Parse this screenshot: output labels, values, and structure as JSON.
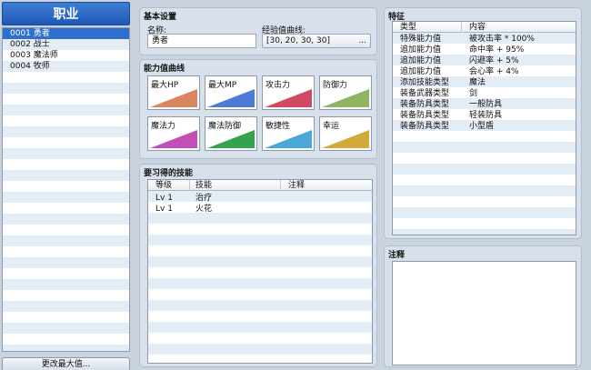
{
  "left": {
    "title": "职业",
    "classes": [
      "0001 勇者",
      "0002 战士",
      "0003 魔法师",
      "0004 牧师"
    ],
    "change_max_button": "更改最大值..."
  },
  "basic": {
    "title": "基本设置",
    "name_label": "名称:",
    "name_value": "勇者",
    "exp_label": "经验值曲线:",
    "exp_value": "[30, 20, 30, 30]",
    "exp_button": "..."
  },
  "curves": {
    "title": "能力值曲线",
    "items": [
      {
        "label": "最大HP",
        "color": "#d98560"
      },
      {
        "label": "最大MP",
        "color": "#4f7ad6"
      },
      {
        "label": "攻击力",
        "color": "#cf4a62"
      },
      {
        "label": "防御力",
        "color": "#90b466"
      },
      {
        "label": "魔法力",
        "color": "#c24fb8"
      },
      {
        "label": "魔法防御",
        "color": "#35a24e"
      },
      {
        "label": "敏捷性",
        "color": "#4aa7d8"
      },
      {
        "label": "幸运",
        "color": "#d2aa3c"
      }
    ]
  },
  "skills": {
    "title": "要习得的技能",
    "headers": [
      "等级",
      "技能",
      "注释"
    ],
    "rows": [
      {
        "level": "Lv  1",
        "skill": "治疗",
        "note": ""
      },
      {
        "level": "Lv  1",
        "skill": "火花",
        "note": ""
      }
    ]
  },
  "traits": {
    "title": "特征",
    "headers": [
      "类型",
      "内容"
    ],
    "rows": [
      {
        "type": "特殊能力值",
        "content": "被攻击率 * 100%"
      },
      {
        "type": "追加能力值",
        "content": "命中率 + 95%"
      },
      {
        "type": "追加能力值",
        "content": "闪避率 + 5%"
      },
      {
        "type": "追加能力值",
        "content": "会心率 + 4%"
      },
      {
        "type": "添加技能类型",
        "content": "魔法"
      },
      {
        "type": "装备武器类型",
        "content": "剑"
      },
      {
        "type": "装备防具类型",
        "content": "一般防具"
      },
      {
        "type": "装备防具类型",
        "content": "轻装防具"
      },
      {
        "type": "装备防具类型",
        "content": "小型盾"
      }
    ]
  },
  "note": {
    "title": "注释",
    "text": ""
  }
}
